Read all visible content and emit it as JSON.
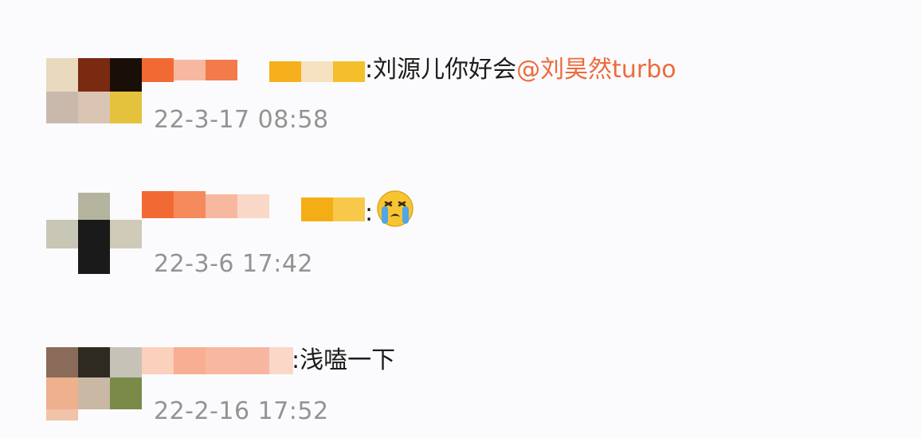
{
  "comments": [
    {
      "separator": ":",
      "text": "刘源儿你好会",
      "mention": "@刘昊然turbo",
      "timestamp": "22-3-17 08:58"
    },
    {
      "separator": ":",
      "text": "",
      "emoji": "crying-face-icon",
      "timestamp": "22-3-6 17:42"
    },
    {
      "separator": ":",
      "text": "浅嗑一下",
      "timestamp": "22-2-16 17:52"
    }
  ]
}
